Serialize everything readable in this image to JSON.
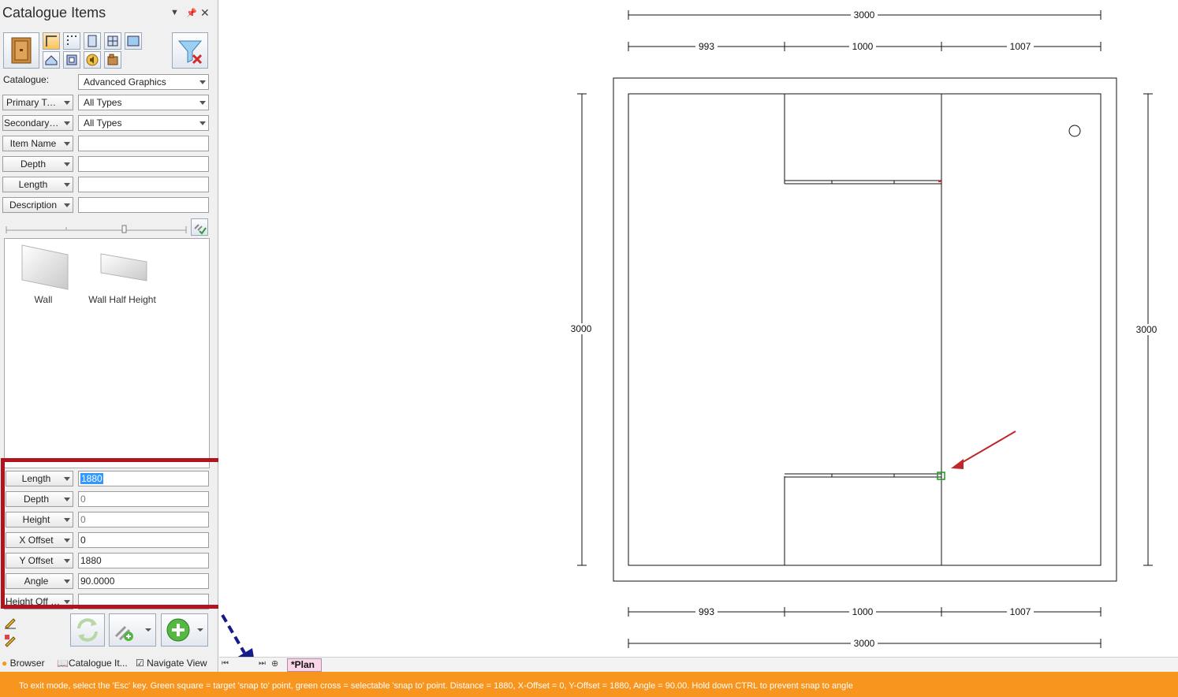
{
  "panel": {
    "title": "Catalogue Items",
    "catalogue_label": "Catalogue:",
    "catalogue_value": "Advanced Graphics",
    "filters": [
      {
        "label": "Primary Type",
        "value": "All Types"
      },
      {
        "label": "Secondary T...",
        "value": "All Types"
      },
      {
        "label": "Item Name",
        "value": ""
      },
      {
        "label": "Depth",
        "value": ""
      },
      {
        "label": "Length",
        "value": ""
      },
      {
        "label": "Description",
        "value": ""
      }
    ],
    "items": [
      {
        "label": "Wall",
        "icon": "wall-icon"
      },
      {
        "label": "Wall Half Height",
        "icon": "wall-half-height-icon"
      }
    ],
    "properties": [
      {
        "label": "Length",
        "value": "1880",
        "selected": true
      },
      {
        "label": "Depth",
        "value": "0"
      },
      {
        "label": "Height",
        "value": "0"
      },
      {
        "label": "X Offset",
        "value": "0"
      },
      {
        "label": "Y Offset",
        "value": "1880"
      },
      {
        "label": "Angle",
        "value": "90.0000"
      },
      {
        "label": "Height Off Fl...",
        "value": ""
      }
    ],
    "bottom_tabs": [
      "Browser",
      "Catalogue It...",
      "Navigate View"
    ]
  },
  "drawing": {
    "dimensions": {
      "top_total": "3000",
      "top_parts": [
        "993",
        "1000",
        "1007"
      ],
      "bottom_parts": [
        "993",
        "1000",
        "1007"
      ],
      "bottom_total": "3000",
      "left": "3000",
      "right": "3000"
    },
    "tab": "*Plan"
  },
  "status": {
    "text": "To exit mode, select the 'Esc' key.  Green square = target 'snap to' point, green cross = selectable 'snap to' point. Distance = 1880, X-Offset = 0, Y-Offset = 1880, Angle = 90.00. Hold down CTRL to prevent snap to angle"
  },
  "colors": {
    "highlight": "#b1141e",
    "status_bar": "#f7951f",
    "snap_target": "#1a9a1a",
    "pointer_arrow": "#c0282d",
    "tab_pink": "#f9d6ea"
  }
}
